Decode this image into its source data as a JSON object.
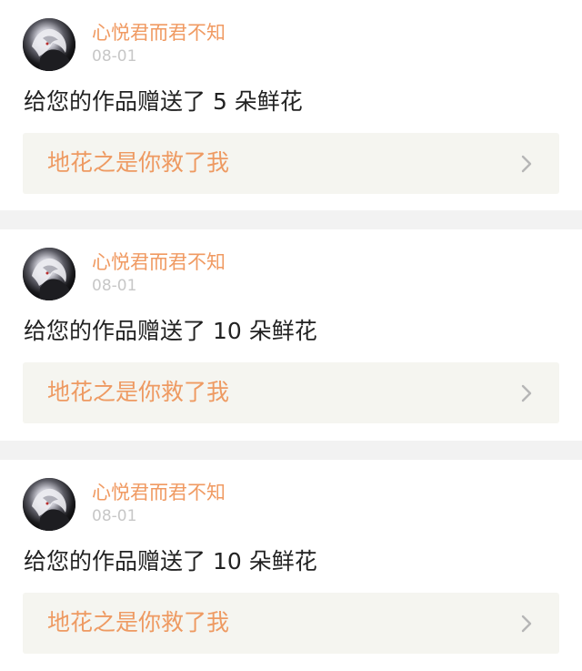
{
  "notifications": [
    {
      "username": "心悦君而君不知",
      "date": "08-01",
      "message": "给您的作品赠送了 5 朵鲜花",
      "work_title": "地花之是你救了我"
    },
    {
      "username": "心悦君而君不知",
      "date": "08-01",
      "message": "给您的作品赠送了 10 朵鲜花",
      "work_title": "地花之是你救了我"
    },
    {
      "username": "心悦君而君不知",
      "date": "08-01",
      "message": "给您的作品赠送了 10 朵鲜花",
      "work_title": "地花之是你救了我"
    }
  ],
  "icons": {
    "avatar": "avatar-image",
    "chevron": "chevron-right-icon"
  },
  "colors": {
    "accent": "#f09a62",
    "date": "#c7c7c7",
    "text": "#222222",
    "link_background": "#f5f5f0",
    "page_background": "#f2f2f2"
  }
}
